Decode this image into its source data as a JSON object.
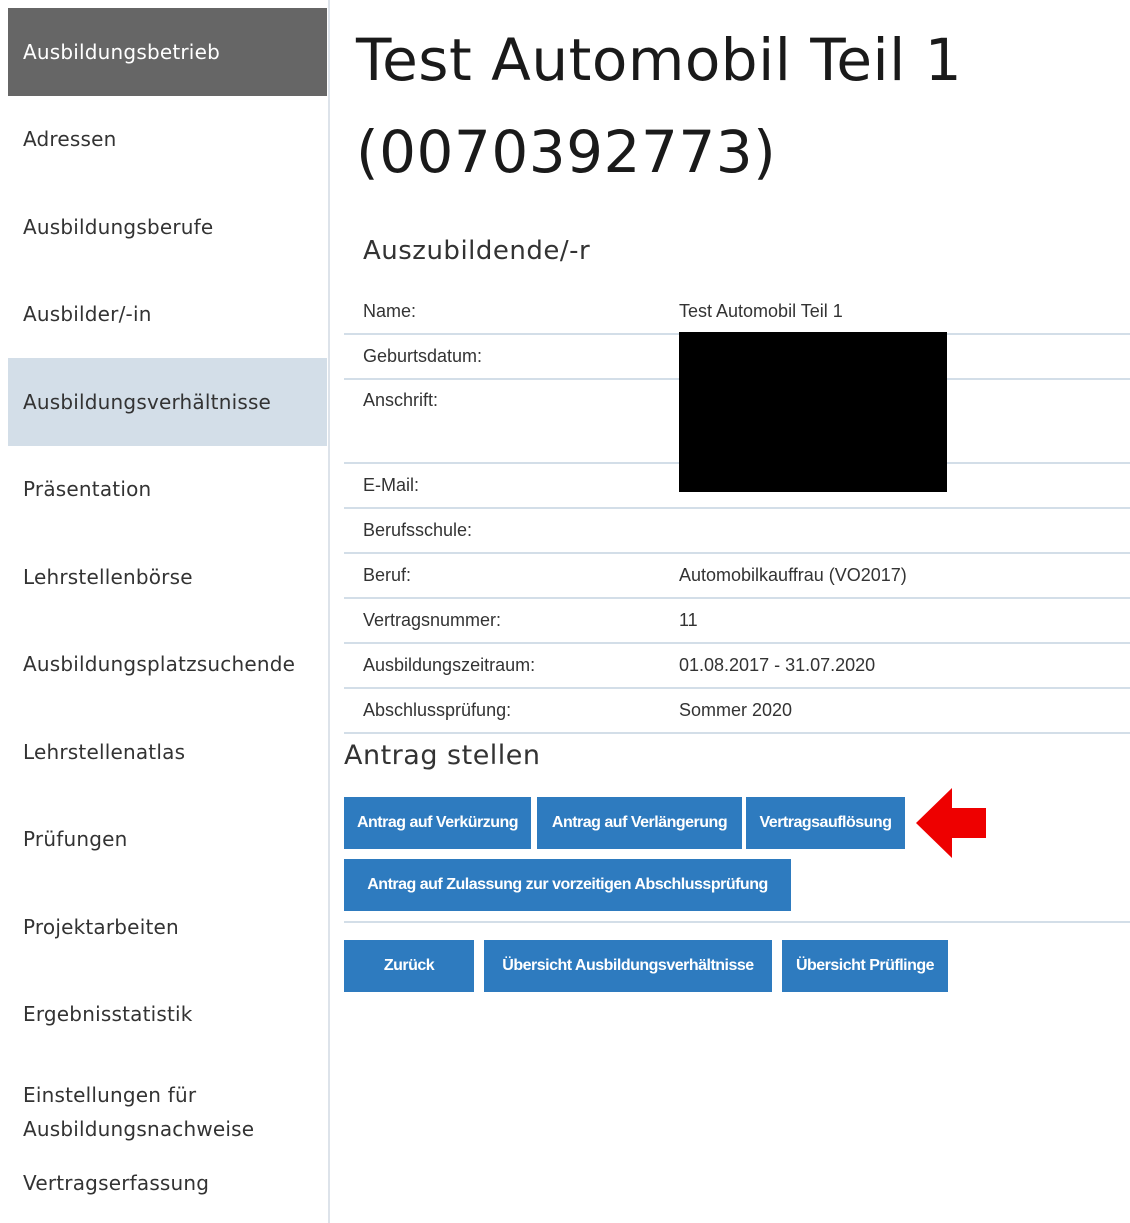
{
  "sidebar": {
    "items": [
      {
        "label": "Ausbildungsbetrieb"
      },
      {
        "label": "Adressen"
      },
      {
        "label": "Ausbildungsberufe"
      },
      {
        "label": "Ausbilder/-in"
      },
      {
        "label": "Ausbildungsverhältnisse"
      },
      {
        "label": "Präsentation"
      },
      {
        "label": "Lehrstellenbörse"
      },
      {
        "label": "Ausbildungsplatzsuchende"
      },
      {
        "label": "Lehrstellenatlas"
      },
      {
        "label": "Prüfungen"
      },
      {
        "label": "Projektarbeiten"
      },
      {
        "label": "Ergebnisstatistik"
      },
      {
        "label_line1": "Einstellungen für",
        "label_line2": "Ausbildungsnachweise"
      },
      {
        "label": "Vertragserfassung"
      }
    ]
  },
  "header": {
    "title": "Test Automobil Teil 1 (0070392773)"
  },
  "trainee": {
    "section_title": "Auszubildende/-r",
    "rows": [
      {
        "label": "Name:",
        "value": "Test Automobil Teil 1"
      },
      {
        "label": "Geburtsdatum:",
        "value": ""
      },
      {
        "label": "Anschrift:",
        "value": ""
      },
      {
        "label": "E-Mail:",
        "value": ""
      },
      {
        "label": "Berufsschule:",
        "value": ""
      },
      {
        "label": "Beruf:",
        "value": "Automobilkauffrau (VO2017)"
      },
      {
        "label": "Vertragsnummer:",
        "value": "11"
      },
      {
        "label": "Ausbildungszeitraum:",
        "value": "01.08.2017 - 31.07.2020"
      },
      {
        "label": "Abschlussprüfung:",
        "value": "Sommer 2020"
      }
    ]
  },
  "antrag": {
    "title": "Antrag stellen",
    "buttons": {
      "verkuerzung": "Antrag auf Verkürzung",
      "verlaengerung": "Antrag auf Verlängerung",
      "aufloesung": "Vertragsauflösung",
      "zulassung": "Antrag auf Zulassung zur vorzeitigen Abschlussprüfung"
    }
  },
  "footer_buttons": {
    "zurueck": "Zurück",
    "uebersicht_verhaeltnisse": "Übersicht Ausbildungsverhältnisse",
    "uebersicht_prueflinge": "Übersicht Prüflinge"
  },
  "colors": {
    "accent": "#2e7bbf",
    "sidebar_head": "#666666",
    "sidebar_active": "#d3dee8",
    "annotation_arrow": "#ee0000"
  }
}
